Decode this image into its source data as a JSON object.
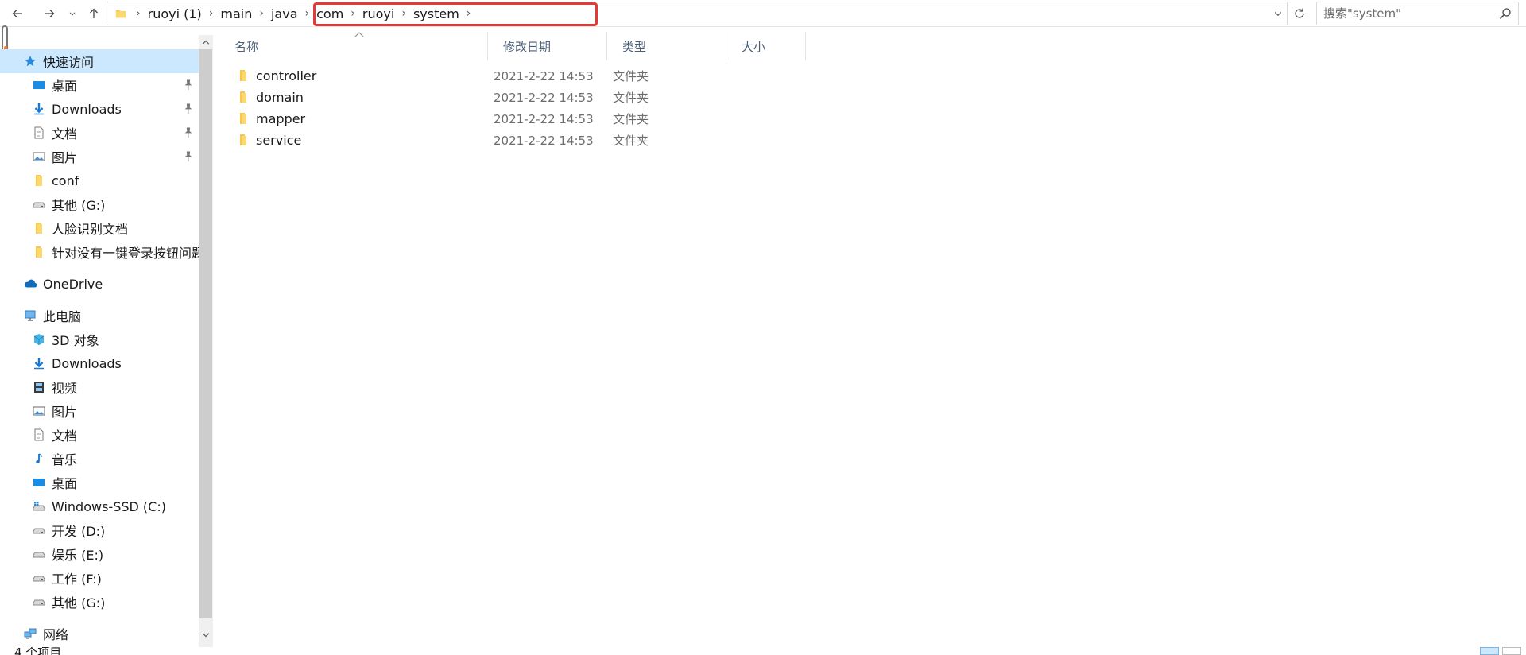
{
  "address_bar": {
    "crumbs_pre": [
      "ruoyi (1)"
    ],
    "crumbs_highlighted": [
      "main",
      "java",
      "com",
      "ruoyi",
      "system"
    ]
  },
  "search": {
    "placeholder": "搜索\"system\""
  },
  "nav_pane": {
    "quick_access": {
      "label": "快速访问",
      "items": [
        {
          "label": "桌面",
          "icon": "desktop-icon",
          "pinned": true
        },
        {
          "label": "Downloads",
          "icon": "download-icon",
          "pinned": true
        },
        {
          "label": "文档",
          "icon": "documents-icon",
          "pinned": true
        },
        {
          "label": "图片",
          "icon": "pictures-icon",
          "pinned": true
        },
        {
          "label": "conf",
          "icon": "folder-icon",
          "pinned": false
        },
        {
          "label": "其他 (G:)",
          "icon": "drive-icon",
          "pinned": false
        },
        {
          "label": "人脸识别文档",
          "icon": "folder-icon",
          "pinned": false
        },
        {
          "label": "针对没有一键登录按钮问题的",
          "icon": "folder-icon",
          "pinned": false
        }
      ]
    },
    "onedrive": {
      "label": "OneDrive"
    },
    "this_pc": {
      "label": "此电脑",
      "items": [
        {
          "label": "3D 对象",
          "icon": "3d-objects-icon"
        },
        {
          "label": "Downloads",
          "icon": "download-icon"
        },
        {
          "label": "视频",
          "icon": "videos-icon"
        },
        {
          "label": "图片",
          "icon": "pictures-icon"
        },
        {
          "label": "文档",
          "icon": "documents-icon"
        },
        {
          "label": "音乐",
          "icon": "music-icon"
        },
        {
          "label": "桌面",
          "icon": "desktop-icon"
        },
        {
          "label": "Windows-SSD (C:)",
          "icon": "system-drive-icon"
        },
        {
          "label": "开发 (D:)",
          "icon": "drive-icon"
        },
        {
          "label": "娱乐 (E:)",
          "icon": "drive-icon"
        },
        {
          "label": "工作 (F:)",
          "icon": "drive-icon"
        },
        {
          "label": "其他 (G:)",
          "icon": "drive-icon"
        }
      ]
    },
    "network": {
      "label": "网络"
    }
  },
  "file_list": {
    "columns": {
      "name": "名称",
      "date": "修改日期",
      "type": "类型",
      "size": "大小"
    },
    "rows": [
      {
        "name": "controller",
        "date": "2021-2-22 14:53",
        "type": "文件夹"
      },
      {
        "name": "domain",
        "date": "2021-2-22 14:53",
        "type": "文件夹"
      },
      {
        "name": "mapper",
        "date": "2021-2-22 14:53",
        "type": "文件夹"
      },
      {
        "name": "service",
        "date": "2021-2-22 14:53",
        "type": "文件夹"
      }
    ]
  },
  "status": {
    "item_count": "4 个项目"
  },
  "colors": {
    "selection": "#cce8ff",
    "highlight_border": "#e53935",
    "folder_yellow": "#f8c74a",
    "column_header_text": "#4c607a"
  }
}
